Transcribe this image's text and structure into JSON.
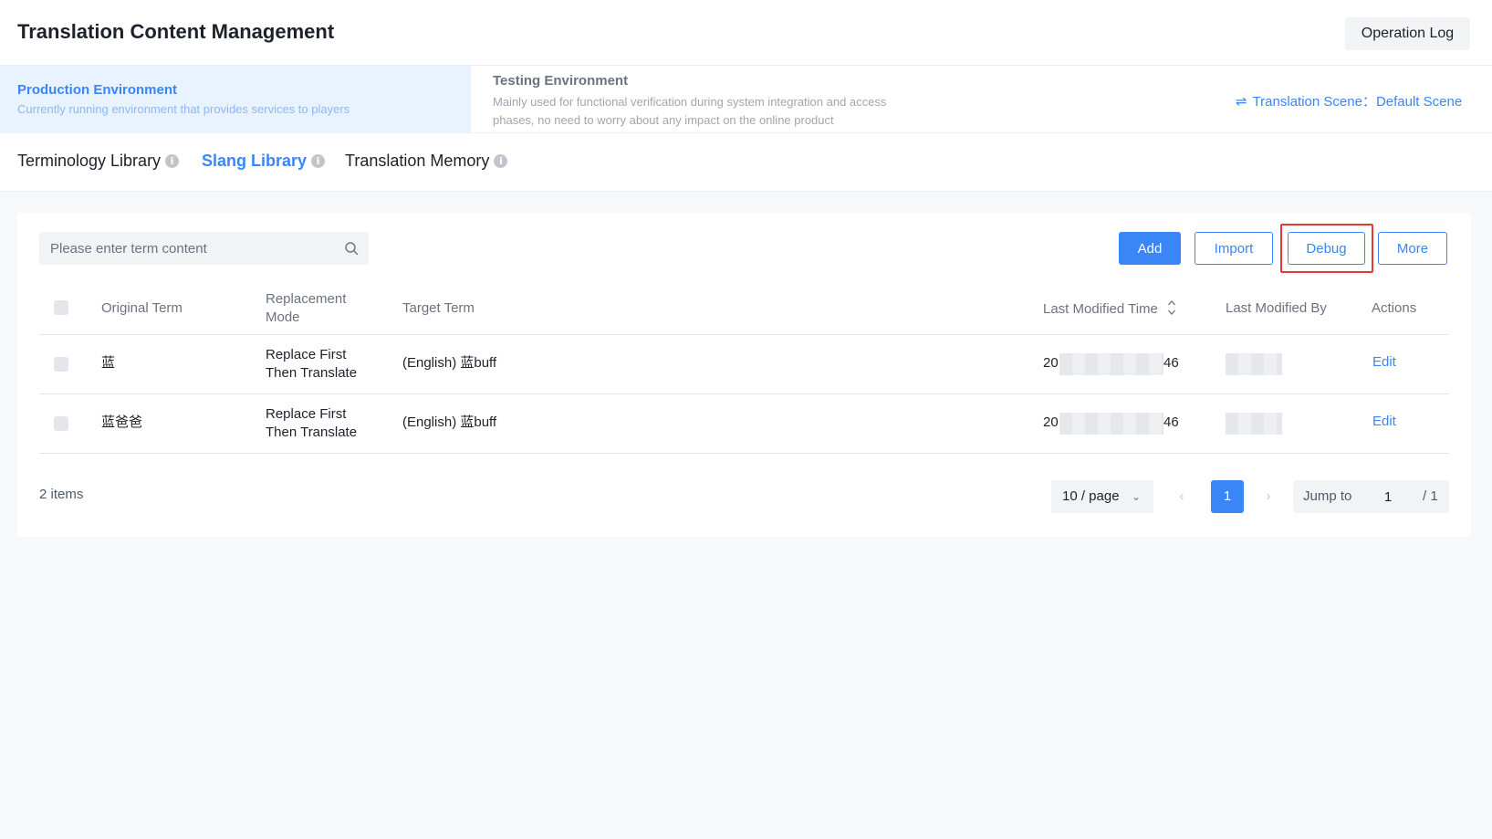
{
  "header": {
    "title": "Translation Content Management",
    "operation_log_label": "Operation Log"
  },
  "environments": {
    "production": {
      "name": "Production Environment",
      "description": "Currently running environment that provides services to players"
    },
    "testing": {
      "name": "Testing Environment",
      "description": "Mainly used for functional verification during system integration and access phases, no need to worry about any impact on the online product"
    },
    "scene_label": "Translation Scene：",
    "scene_value": "Default Scene"
  },
  "tabs": [
    {
      "label": "Terminology Library",
      "active": false
    },
    {
      "label": "Slang Library",
      "active": true
    },
    {
      "label": "Translation Memory",
      "active": false
    }
  ],
  "toolbar": {
    "search_placeholder": "Please enter term content",
    "add_label": "Add",
    "import_label": "Import",
    "debug_label": "Debug",
    "more_label": "More"
  },
  "table": {
    "columns": {
      "original_term": "Original Term",
      "replacement_mode": "Replacement Mode",
      "target_term": "Target Term",
      "last_modified_time": "Last Modified Time",
      "last_modified_by": "Last Modified By",
      "actions": "Actions"
    },
    "rows": [
      {
        "original_term": "蓝",
        "replacement_mode": "Replace First Then Translate",
        "target_term": "(English) 蓝buff",
        "time_prefix": "20",
        "time_suffix": "46",
        "action": "Edit"
      },
      {
        "original_term": "蓝爸爸",
        "replacement_mode": "Replace First Then Translate",
        "target_term": "(English) 蓝buff",
        "time_prefix": "20",
        "time_suffix": "46",
        "action": "Edit"
      }
    ]
  },
  "pagination": {
    "total": "2 items",
    "page_size": "10 / page",
    "current_page": "1",
    "jump_label": "Jump to",
    "jump_value": "1",
    "total_pages": "/ 1"
  },
  "colors": {
    "accent": "#3a86f7",
    "highlight": "#e53935"
  }
}
